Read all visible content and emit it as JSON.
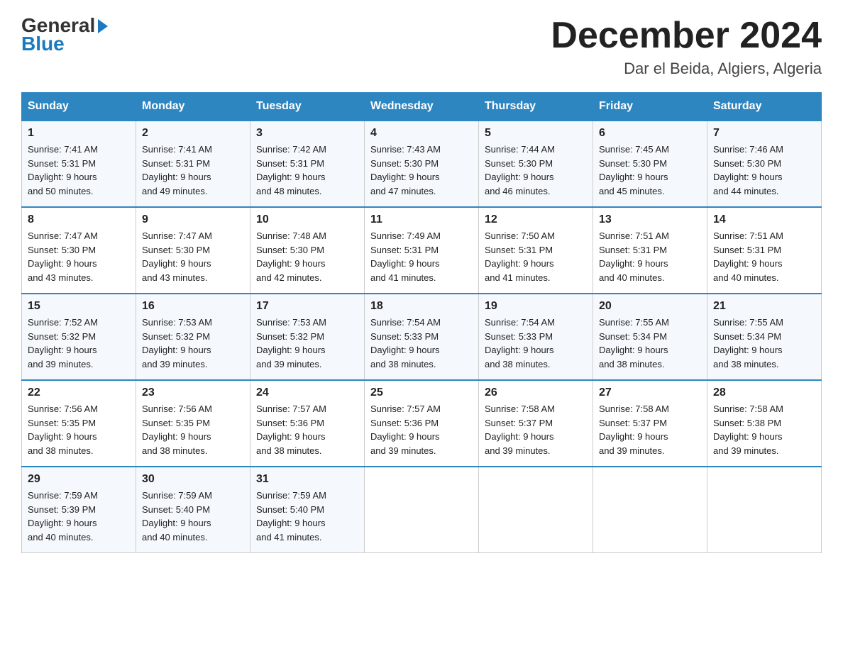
{
  "logo": {
    "general": "General",
    "blue": "Blue"
  },
  "header": {
    "title": "December 2024",
    "subtitle": "Dar el Beida, Algiers, Algeria"
  },
  "weekdays": [
    "Sunday",
    "Monday",
    "Tuesday",
    "Wednesday",
    "Thursday",
    "Friday",
    "Saturday"
  ],
  "weeks": [
    [
      {
        "day": "1",
        "sunrise": "7:41 AM",
        "sunset": "5:31 PM",
        "daylight": "9 hours and 50 minutes."
      },
      {
        "day": "2",
        "sunrise": "7:41 AM",
        "sunset": "5:31 PM",
        "daylight": "9 hours and 49 minutes."
      },
      {
        "day": "3",
        "sunrise": "7:42 AM",
        "sunset": "5:31 PM",
        "daylight": "9 hours and 48 minutes."
      },
      {
        "day": "4",
        "sunrise": "7:43 AM",
        "sunset": "5:30 PM",
        "daylight": "9 hours and 47 minutes."
      },
      {
        "day": "5",
        "sunrise": "7:44 AM",
        "sunset": "5:30 PM",
        "daylight": "9 hours and 46 minutes."
      },
      {
        "day": "6",
        "sunrise": "7:45 AM",
        "sunset": "5:30 PM",
        "daylight": "9 hours and 45 minutes."
      },
      {
        "day": "7",
        "sunrise": "7:46 AM",
        "sunset": "5:30 PM",
        "daylight": "9 hours and 44 minutes."
      }
    ],
    [
      {
        "day": "8",
        "sunrise": "7:47 AM",
        "sunset": "5:30 PM",
        "daylight": "9 hours and 43 minutes."
      },
      {
        "day": "9",
        "sunrise": "7:47 AM",
        "sunset": "5:30 PM",
        "daylight": "9 hours and 43 minutes."
      },
      {
        "day": "10",
        "sunrise": "7:48 AM",
        "sunset": "5:30 PM",
        "daylight": "9 hours and 42 minutes."
      },
      {
        "day": "11",
        "sunrise": "7:49 AM",
        "sunset": "5:31 PM",
        "daylight": "9 hours and 41 minutes."
      },
      {
        "day": "12",
        "sunrise": "7:50 AM",
        "sunset": "5:31 PM",
        "daylight": "9 hours and 41 minutes."
      },
      {
        "day": "13",
        "sunrise": "7:51 AM",
        "sunset": "5:31 PM",
        "daylight": "9 hours and 40 minutes."
      },
      {
        "day": "14",
        "sunrise": "7:51 AM",
        "sunset": "5:31 PM",
        "daylight": "9 hours and 40 minutes."
      }
    ],
    [
      {
        "day": "15",
        "sunrise": "7:52 AM",
        "sunset": "5:32 PM",
        "daylight": "9 hours and 39 minutes."
      },
      {
        "day": "16",
        "sunrise": "7:53 AM",
        "sunset": "5:32 PM",
        "daylight": "9 hours and 39 minutes."
      },
      {
        "day": "17",
        "sunrise": "7:53 AM",
        "sunset": "5:32 PM",
        "daylight": "9 hours and 39 minutes."
      },
      {
        "day": "18",
        "sunrise": "7:54 AM",
        "sunset": "5:33 PM",
        "daylight": "9 hours and 38 minutes."
      },
      {
        "day": "19",
        "sunrise": "7:54 AM",
        "sunset": "5:33 PM",
        "daylight": "9 hours and 38 minutes."
      },
      {
        "day": "20",
        "sunrise": "7:55 AM",
        "sunset": "5:34 PM",
        "daylight": "9 hours and 38 minutes."
      },
      {
        "day": "21",
        "sunrise": "7:55 AM",
        "sunset": "5:34 PM",
        "daylight": "9 hours and 38 minutes."
      }
    ],
    [
      {
        "day": "22",
        "sunrise": "7:56 AM",
        "sunset": "5:35 PM",
        "daylight": "9 hours and 38 minutes."
      },
      {
        "day": "23",
        "sunrise": "7:56 AM",
        "sunset": "5:35 PM",
        "daylight": "9 hours and 38 minutes."
      },
      {
        "day": "24",
        "sunrise": "7:57 AM",
        "sunset": "5:36 PM",
        "daylight": "9 hours and 38 minutes."
      },
      {
        "day": "25",
        "sunrise": "7:57 AM",
        "sunset": "5:36 PM",
        "daylight": "9 hours and 39 minutes."
      },
      {
        "day": "26",
        "sunrise": "7:58 AM",
        "sunset": "5:37 PM",
        "daylight": "9 hours and 39 minutes."
      },
      {
        "day": "27",
        "sunrise": "7:58 AM",
        "sunset": "5:37 PM",
        "daylight": "9 hours and 39 minutes."
      },
      {
        "day": "28",
        "sunrise": "7:58 AM",
        "sunset": "5:38 PM",
        "daylight": "9 hours and 39 minutes."
      }
    ],
    [
      {
        "day": "29",
        "sunrise": "7:59 AM",
        "sunset": "5:39 PM",
        "daylight": "9 hours and 40 minutes."
      },
      {
        "day": "30",
        "sunrise": "7:59 AM",
        "sunset": "5:40 PM",
        "daylight": "9 hours and 40 minutes."
      },
      {
        "day": "31",
        "sunrise": "7:59 AM",
        "sunset": "5:40 PM",
        "daylight": "9 hours and 41 minutes."
      },
      null,
      null,
      null,
      null
    ]
  ],
  "labels": {
    "sunrise": "Sunrise:",
    "sunset": "Sunset:",
    "daylight": "Daylight:"
  }
}
